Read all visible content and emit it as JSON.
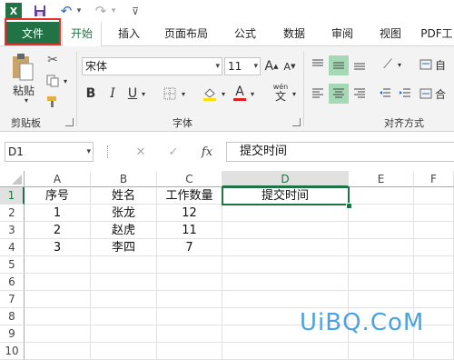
{
  "qat": {
    "excel_logo": "X",
    "undo_glyph": "↶",
    "redo_glyph": "↷",
    "dropdown_glyph": "▾",
    "customize_glyph": "⊽"
  },
  "tabs": [
    {
      "label": "文件"
    },
    {
      "label": "开始"
    },
    {
      "label": "插入"
    },
    {
      "label": "页面布局"
    },
    {
      "label": "公式"
    },
    {
      "label": "数据"
    },
    {
      "label": "审阅"
    },
    {
      "label": "视图"
    },
    {
      "label": "PDF工"
    }
  ],
  "ribbon": {
    "clipboard": {
      "paste_label": "粘贴",
      "group_label": "剪贴板"
    },
    "font": {
      "font_name": "宋体",
      "font_size": "11",
      "bold": "B",
      "italic": "I",
      "underline": "U",
      "grow": "A",
      "shrink": "A",
      "font_color_letter": "A",
      "phonetic_label": "wén",
      "phonetic_letter": "文",
      "group_label": "字体"
    },
    "alignment": {
      "group_label": "对齐方式",
      "wrap_label": "自",
      "merge_label": "合"
    }
  },
  "formula_bar": {
    "name_box": "D1",
    "cancel_glyph": "✕",
    "enter_glyph": "✓",
    "fx_label": "fx",
    "content": "提交时间"
  },
  "sheet": {
    "columns": [
      "A",
      "B",
      "C",
      "D",
      "E",
      "F"
    ],
    "rows": [
      "1",
      "2",
      "3",
      "4",
      "5",
      "6",
      "7",
      "8",
      "9",
      "10"
    ],
    "cells": [
      [
        "序号",
        "姓名",
        "工作数量",
        "提交时间",
        "",
        ""
      ],
      [
        "1",
        "张龙",
        "12",
        "",
        "",
        ""
      ],
      [
        "2",
        "赵虎",
        "11",
        "",
        "",
        ""
      ],
      [
        "3",
        "李四",
        "7",
        "",
        "",
        ""
      ]
    ]
  },
  "watermark": "UiBQ.CoM",
  "colors": {
    "excel_green": "#217346",
    "highlight_red": "#e8302a",
    "watermark_blue": "#4aa3e0"
  }
}
